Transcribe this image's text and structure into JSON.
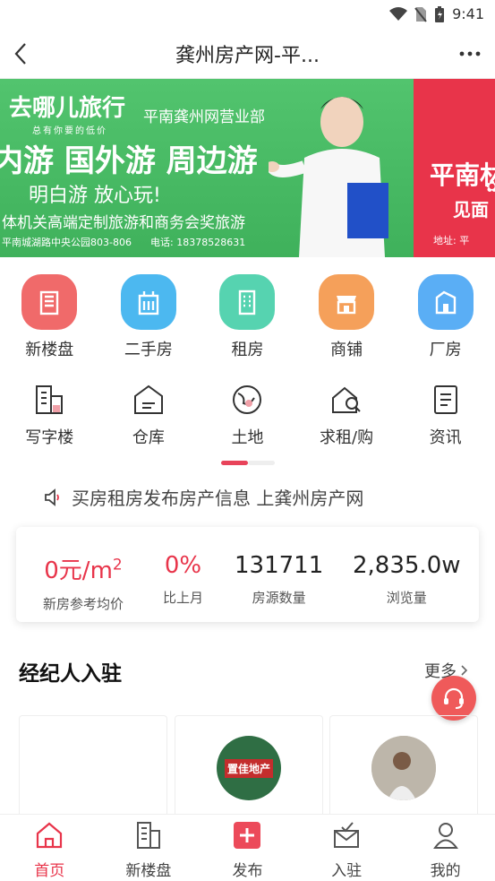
{
  "status": {
    "time": "9:41"
  },
  "nav": {
    "title": "龚州房产网-平..."
  },
  "banner": {
    "brand": "去哪儿旅行",
    "brand_sub": "总有你要的低价",
    "branch": "平南龚州网营业部",
    "headline": "内游 国外游 周边游",
    "slogan": "明白游 放心玩!",
    "line": "体机关高端定制旅游和商务会奖旅游",
    "address": "平南城湖路中央公园803-806",
    "phone": "电话: 18378528631",
    "red_headline": "平南林",
    "red_sub": "见面",
    "red_addr": "地址: 平"
  },
  "categories": [
    {
      "label": "新楼盘",
      "icon": "new-building-icon",
      "color": "#f06a6a"
    },
    {
      "label": "二手房",
      "icon": "secondhand-house-icon",
      "color": "#4cb8f0"
    },
    {
      "label": "租房",
      "icon": "rent-icon",
      "color": "#56d3b0"
    },
    {
      "label": "商铺",
      "icon": "shop-icon",
      "color": "#f5a05a"
    },
    {
      "label": "厂房",
      "icon": "factory-icon",
      "color": "#5aaef5"
    }
  ],
  "categories2": [
    {
      "label": "写字楼",
      "icon": "office-icon"
    },
    {
      "label": "仓库",
      "icon": "warehouse-icon"
    },
    {
      "label": "土地",
      "icon": "land-icon"
    },
    {
      "label": "求租/购",
      "icon": "wanted-icon"
    },
    {
      "label": "资讯",
      "icon": "news-icon"
    }
  ],
  "notice": {
    "text": "买房租房发布房产信息 上龚州房产网"
  },
  "stats": {
    "avg_price_value": "0元/m",
    "avg_price_sup": "2",
    "avg_price_label": "新房参考均价",
    "mom_value": "0%",
    "mom_label": "比上月",
    "listings_value": "131711",
    "listings_label": "房源数量",
    "views_value": "2,835.0w",
    "views_label": "浏览量"
  },
  "agents_section": {
    "title": "经纪人入驻",
    "more": "更多"
  },
  "agents": [
    {
      "avatar_text": ""
    },
    {
      "avatar_text": "置佳地产"
    },
    {
      "avatar_text": ""
    }
  ],
  "tabs": [
    {
      "label": "首页",
      "icon": "home-icon",
      "active": true
    },
    {
      "label": "新楼盘",
      "icon": "buildings-icon",
      "active": false
    },
    {
      "label": "发布",
      "icon": "publish-icon",
      "active": false
    },
    {
      "label": "入驻",
      "icon": "join-icon",
      "active": false
    },
    {
      "label": "我的",
      "icon": "profile-icon",
      "active": false
    }
  ],
  "colors": {
    "accent": "#e8344a",
    "banner_green": "#4bbb66"
  }
}
